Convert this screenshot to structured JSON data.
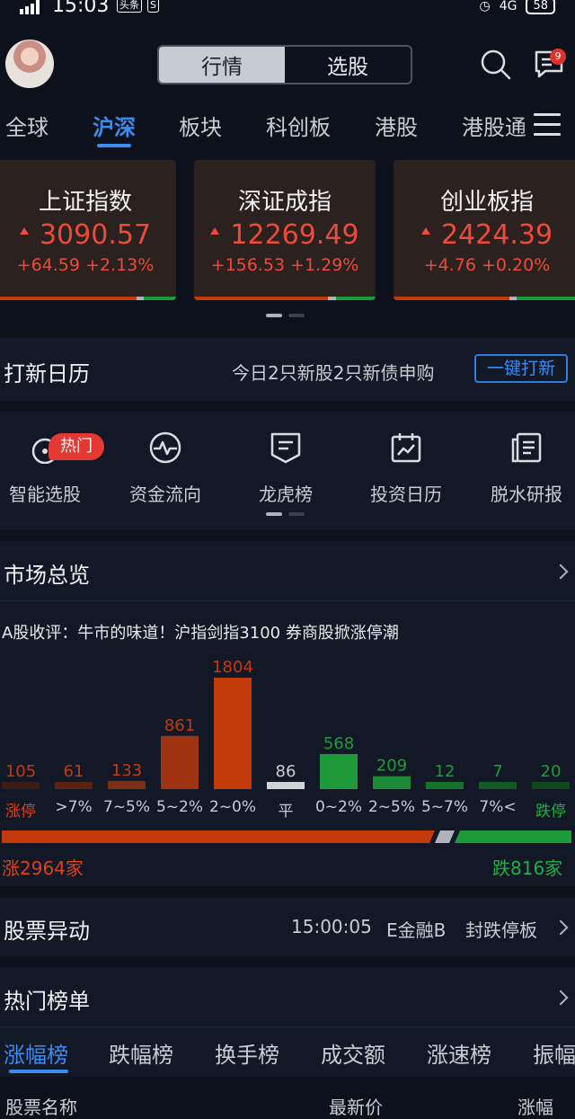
{
  "status_bar": {
    "time": "15:03",
    "mini_icon_1": "头条",
    "mini_icon_2": "S",
    "battery": "58",
    "network": "4G"
  },
  "header": {
    "seg_tabs": [
      "行情",
      "选股"
    ],
    "active_seg": "行情",
    "message_badge": "9"
  },
  "market_tabs": [
    "全球",
    "沪深",
    "板块",
    "科创板",
    "港股",
    "港股通"
  ],
  "active_market_tab": "沪深",
  "indices": [
    {
      "name": "上证指数",
      "value": "3090.57",
      "change": "+64.59 +2.13%"
    },
    {
      "name": "深证成指",
      "value": "12269.49",
      "change": "+156.53 +1.29%"
    },
    {
      "name": "创业板指",
      "value": "2424.39",
      "change": "+4.76 +0.20%"
    }
  ],
  "ipo": {
    "title": "打新日历",
    "summary": "今日2只新股2只新债申购",
    "button": "一键打新"
  },
  "tools": [
    {
      "label": "智能选股",
      "icon": "smart-picker-icon",
      "badge": "热门"
    },
    {
      "label": "资金流向",
      "icon": "pulse-icon"
    },
    {
      "label": "龙虎榜",
      "icon": "dragon-tiger-list-icon"
    },
    {
      "label": "投资日历",
      "icon": "calendar-chart-icon"
    },
    {
      "label": "脱水研报",
      "icon": "report-icon"
    }
  ],
  "market_overview": {
    "title": "市场总览",
    "headline": "A股收评：牛市的味道！沪指剑指3100 券商股掀涨停潮",
    "up_summary": "涨2964家",
    "down_summary": "跌816家"
  },
  "chart_data": {
    "type": "bar",
    "categories": [
      "涨停",
      ">7%",
      "7~5%",
      "5~2%",
      "2~0%",
      "平",
      "0~2%",
      "2~5%",
      "5~7%",
      "7%<",
      "跌停"
    ],
    "values": [
      105,
      61,
      133,
      861,
      1804,
      86,
      568,
      209,
      12,
      7,
      20
    ],
    "colors": [
      "#3a1c14",
      "#5a2414",
      "#7a2e14",
      "#a03412",
      "#c23a0a",
      "#d0d3d8",
      "#1f9a3a",
      "#1c8a34",
      "#17722c",
      "#125a24",
      "#0e4a1e"
    ],
    "label_colors": [
      "#c23a0a",
      "#c23a0a",
      "#c23a0a",
      "#c23a0a",
      "#c23a0a",
      "#c9ccd2",
      "#1f9a3a",
      "#1f9a3a",
      "#1f9a3a",
      "#1f9a3a",
      "#1f9a3a"
    ],
    "ylim": [
      0,
      1804
    ]
  },
  "stock_alert": {
    "title": "股票异动",
    "time": "15:00:05",
    "stock": "E金融B",
    "event": "封跌停板"
  },
  "hot_list": {
    "title": "热门榜单",
    "tabs": [
      "涨幅榜",
      "跌幅榜",
      "换手榜",
      "成交额",
      "涨速榜",
      "振幅"
    ],
    "active": "涨幅榜",
    "columns": [
      "股票名称",
      "最新价",
      "涨幅"
    ]
  }
}
